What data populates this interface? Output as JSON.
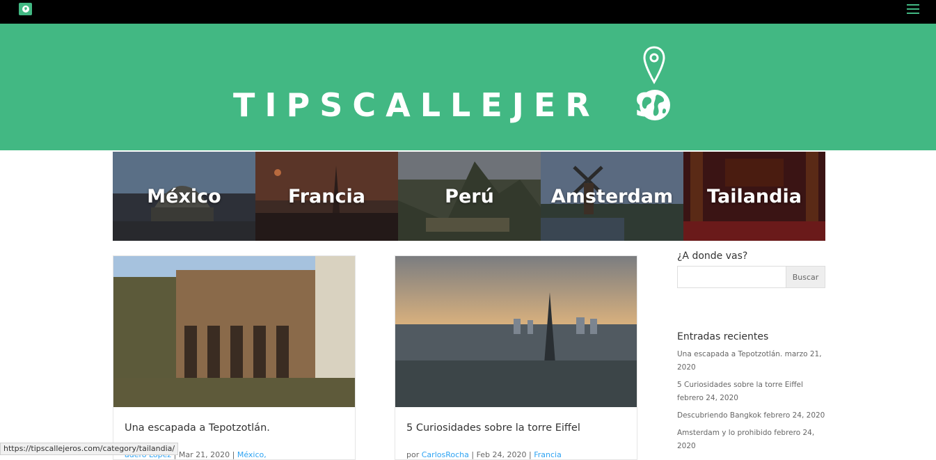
{
  "header": {
    "menu_icon": "hamburger-menu-icon"
  },
  "brand": {
    "text_prefix": "TIPSCALLEJER",
    "text_suffix": "S"
  },
  "categories": [
    {
      "label": "México"
    },
    {
      "label": "Francia"
    },
    {
      "label": "Perú"
    },
    {
      "label": "Amsterdam"
    },
    {
      "label": "Tailandia"
    }
  ],
  "posts": [
    {
      "title": "Una escapada a Tepotzotlán.",
      "author": "adero López",
      "date": "Mar 21, 2020",
      "category": "México,"
    },
    {
      "title": "5 Curiosidades sobre la torre Eiffel",
      "by": "por",
      "author": "CarlosRocha",
      "date": "Feb 24, 2020",
      "category": "Francia"
    }
  ],
  "sidebar": {
    "search_heading": "¿A donde vas?",
    "search_button": "Buscar",
    "search_value": "",
    "recent_heading": "Entradas recientes",
    "recent": [
      "Una escapada a Tepotzotlán. marzo 21, 2020",
      "5 Curiosidades sobre la torre Eiffel febrero 24, 2020",
      "Descubriendo Bangkok febrero 24, 2020",
      "Amsterdam y lo prohibido febrero 24, 2020"
    ]
  },
  "status": {
    "url": "https://tipscallejeros.com/category/tailandia/"
  },
  "colors": {
    "brand_green": "#42b883",
    "link_blue": "#2ea3f2"
  }
}
